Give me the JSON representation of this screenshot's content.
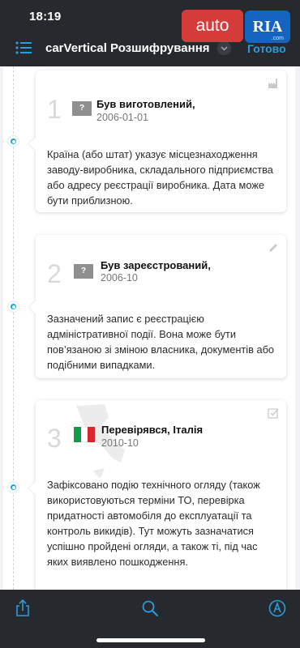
{
  "status_bar": {
    "time": "18:19"
  },
  "header": {
    "title": "carVertical  Розшифрування VIN",
    "done_label": "Готово",
    "list_icon": "list-icon",
    "chevron_icon": "chevron-down-icon"
  },
  "watermark": {
    "auto": "auto",
    "ria": "RIA",
    "com": ".com"
  },
  "events": [
    {
      "number": "1",
      "flag": "?",
      "title": "Був виготовлений,",
      "date": "2006-01-01",
      "corner_icon": "factory-icon",
      "description": "Країна (або штат) указує місцезнаходження заводу-виробника, складального підприємства або адресу реєстрації виробника. Дата може бути приблизною."
    },
    {
      "number": "2",
      "flag": "?",
      "title": "Був зареєстрований,",
      "date": "2006-10",
      "corner_icon": "pencil-icon",
      "description": "Зазначений запис є реєстрацією адміністративної події. Вона може бути пов’язаною зі зміною власника, документів або подібними випадками."
    },
    {
      "number": "3",
      "flag": "italy",
      "title": "Перевірявся, Італія",
      "date": "2010-10",
      "corner_icon": "checkbox-icon",
      "description": "Зафіксовано подію технічного огляду (також використовуються терміни ТО, перевірка придатності автомобіля до експлуатації та контроль викидів). Тут можуть зазначатися успішно пройдені огляди, а також ті, під час яких виявлено пошкодження."
    }
  ],
  "toolbar": {
    "share_icon": "share-icon",
    "search_icon": "search-icon",
    "markup_icon": "markup-icon"
  },
  "colors": {
    "bar_bg": "#26292e",
    "accent": "#16a5e0",
    "link": "#2e9bd9",
    "italy_green": "#0f9b48",
    "italy_red": "#d7262e"
  }
}
